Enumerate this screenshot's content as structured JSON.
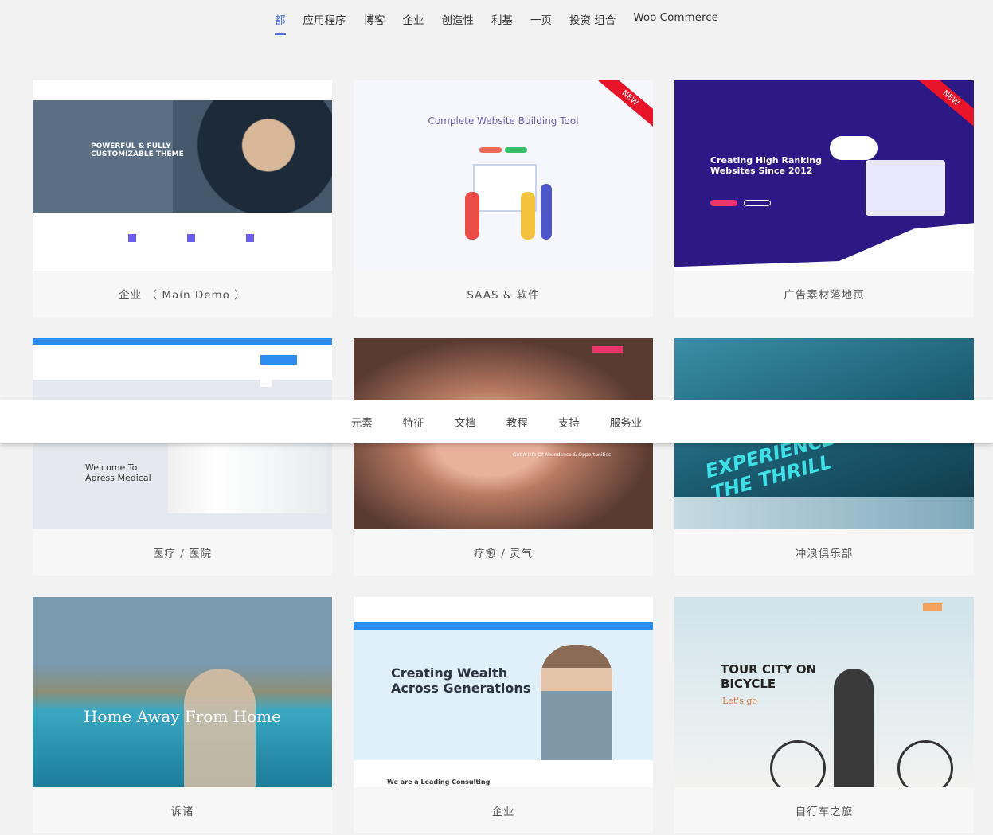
{
  "filters": [
    "都",
    "应用程序",
    "博客",
    "企业",
    "创造性",
    "利基",
    "一页",
    "投资 组合",
    "Woo Commerce"
  ],
  "active_filter": "都",
  "subnav": [
    "元素",
    "特征",
    "文档",
    "教程",
    "支持",
    "服务业"
  ],
  "cards": [
    {
      "caption": "企业 （ Main Demo ）",
      "headline": "POWERFUL & FULLY CUSTOMIZABLE THEME"
    },
    {
      "caption": "SAAS & 软件",
      "headline": "Complete Website Building Tool",
      "badge": "NEW"
    },
    {
      "caption": "广告素材落地页",
      "headline": "Creating High Ranking Websites Since 2012",
      "badge": "NEW"
    },
    {
      "caption": "医疗 / 医院",
      "headline": "Welcome To Apress Medical"
    },
    {
      "caption": "疗愈 / 灵气",
      "headline": "Get A Life Of Abundance & Opportunities"
    },
    {
      "caption": "冲浪俱乐部",
      "headline": "EXPERIENCE THE THRILL"
    },
    {
      "caption": "诉诸",
      "headline": "Home Away From Home"
    },
    {
      "caption": "企业",
      "headline": "Creating Wealth Across Generations",
      "sub": "We are a Leading Consulting"
    },
    {
      "caption": "自行车之旅",
      "headline": "TOUR CITY ON BICYCLE",
      "sub": "Let's go"
    }
  ],
  "colors": {
    "accent": "#4a6de5",
    "ribbon": "#e8152a"
  }
}
